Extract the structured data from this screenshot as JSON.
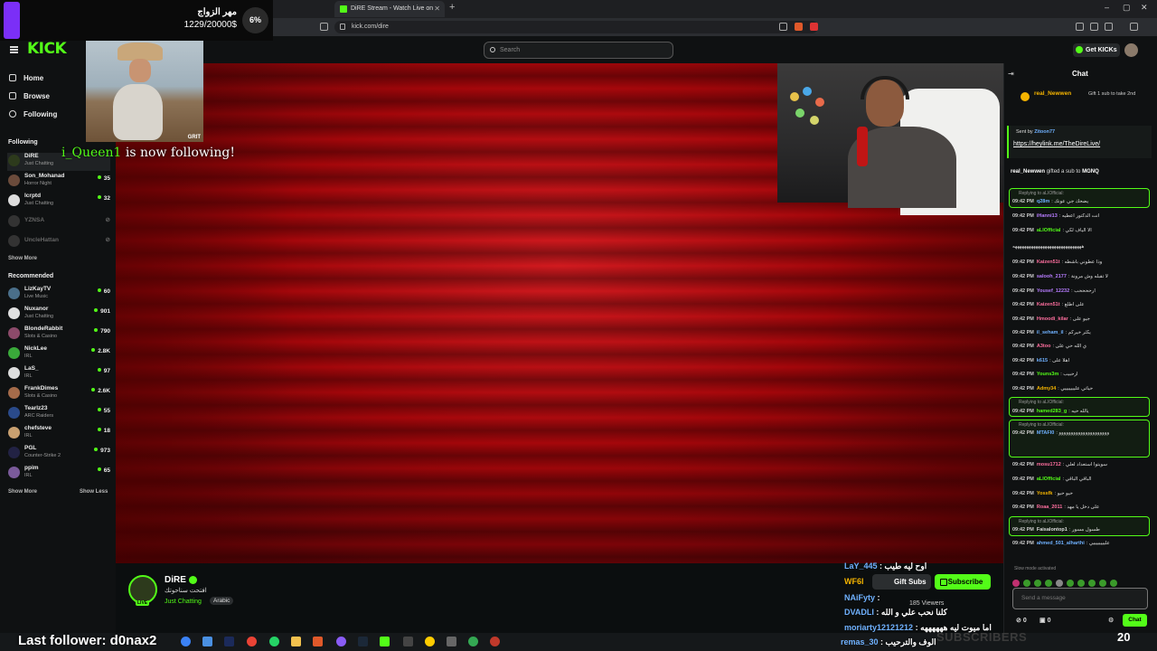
{
  "browser": {
    "tab_title": "DiRE Stream - Watch Live on",
    "url": "kick.com/dire"
  },
  "topnav": {
    "logo": "KICK",
    "search_placeholder": "Search",
    "get_kicks": "Get KICKs"
  },
  "sidebar": {
    "nav": [
      {
        "label": "Home"
      },
      {
        "label": "Browse"
      },
      {
        "label": "Following"
      }
    ],
    "following_title": "Following",
    "following": [
      {
        "name": "DiRE",
        "category": "Just Chatting",
        "viewers": ""
      },
      {
        "name": "Son_Mohanad",
        "category": "Horror Night",
        "viewers": "35"
      },
      {
        "name": "lcrptd",
        "category": "Just Chatting",
        "viewers": "32"
      },
      {
        "name": "YZNSA",
        "category": "",
        "viewers": ""
      },
      {
        "name": "UncleHattan",
        "category": "",
        "viewers": ""
      }
    ],
    "show_more_1": "Show More",
    "recommended_title": "Recommended",
    "recommended": [
      {
        "name": "LizKayTV",
        "category": "Live Music",
        "viewers": "60"
      },
      {
        "name": "Nuxanor",
        "category": "Just Chatting",
        "viewers": "901"
      },
      {
        "name": "BlondeRabbit",
        "category": "Slots & Casino",
        "viewers": "790"
      },
      {
        "name": "NickLee",
        "category": "IRL",
        "viewers": "2.8K"
      },
      {
        "name": "LaS_",
        "category": "IRL",
        "viewers": "97"
      },
      {
        "name": "FrankDimes",
        "category": "Slots & Casino",
        "viewers": "2.6K"
      },
      {
        "name": "Tearlz23",
        "category": "ARC Raiders",
        "viewers": "55"
      },
      {
        "name": "chefsteve",
        "category": "IRL",
        "viewers": "18"
      },
      {
        "name": "PGL",
        "category": "Counter-Strike 2",
        "viewers": "973"
      },
      {
        "name": "ppim",
        "category": "IRL",
        "viewers": "65"
      }
    ],
    "show_more_2": "Show More",
    "show_less": "Show Less"
  },
  "overlay": {
    "goal_title": "مهر الزواج",
    "goal_amount": "1229/20000$",
    "goal_percent": "6%",
    "clip_label": "GRIT",
    "follow_user": "i_Queen1",
    "follow_text": "is now following!",
    "last_follower": "Last follower: d0nax2",
    "subscribers_label": "SUBSCRIBERS",
    "subscribers_count": "20",
    "chat": [
      {
        "user": "LaY_445",
        "msg": "اوح ليه طيب"
      },
      {
        "user": "WF6l",
        "msg": ""
      },
      {
        "user": "NAiFyty",
        "msg": ""
      },
      {
        "user": "DVADLI",
        "msg": "كلنا نحب علي و الله"
      },
      {
        "user": "moriarty12121212",
        "msg": "اما ميوت ليه ههههههه"
      },
      {
        "user": "remas_30",
        "msg": "الوف والترحيب"
      }
    ]
  },
  "channel": {
    "name": "DiRE",
    "title": "افتحت سناحوتك",
    "category": "Just Chatting",
    "tag": "Arabic",
    "gift_subs": "Gift Subs",
    "subscribe": "Subscribe",
    "viewers": "185 Viewers",
    "live": "LIVE"
  },
  "chat": {
    "title": "Chat",
    "pinned_user": "real_Newwen",
    "pinned_text": "Gift 1 sub to take 2nd",
    "sent_by_prefix": "Sent by",
    "sent_by_user": "Zitoon77",
    "sent_link": "https://heylink.me/TheDireLive/",
    "gift_user": "real_Newwen",
    "gift_text": "gifted a sub to",
    "gift_target": "MGNQ",
    "messages": [
      {
        "reply": "Replying to aLIOfficial:",
        "time": "09:42 PM",
        "user": "q28m",
        "color": "#6fb1ff",
        "text": "يضحك جي عونك"
      },
      {
        "reply": "",
        "time": "09:42 PM",
        "user": "iHanni13",
        "color": "#b77cff",
        "text": "انت الدكتور اعطيه"
      },
      {
        "reply": "",
        "time": "09:42 PM",
        "user": "aLIOfficial",
        "color": "#53fc18",
        "text": "الا الياف لكي"
      },
      {
        "reply": "",
        "time": "",
        "user": "",
        "color": "#ddd",
        "text": "ههههههههههههههههههههههههههههههه"
      },
      {
        "reply": "",
        "time": "09:42 PM",
        "user": "Kaizen51t",
        "color": "#ff6f9f",
        "text": "وذا عطوني باشطه"
      },
      {
        "reply": "",
        "time": "09:42 PM",
        "user": "salooh_2177",
        "color": "#b77cff",
        "text": "لا تقبله وش مرونة"
      },
      {
        "reply": "",
        "time": "09:42 PM",
        "user": "Yousef_12232",
        "color": "#b77cff",
        "text": "ارححححب"
      },
      {
        "reply": "",
        "time": "09:42 PM",
        "user": "Kaizen51t",
        "color": "#ff6f9f",
        "text": "على اطلع"
      },
      {
        "reply": "",
        "time": "09:42 PM",
        "user": "Hmoodi_kilar",
        "color": "#ff6f9f",
        "text": "جيو على"
      },
      {
        "reply": "",
        "time": "09:42 PM",
        "user": "il_seham_il",
        "color": "#6fb1ff",
        "text": "يكثر خيركم"
      },
      {
        "reply": "",
        "time": "09:42 PM",
        "user": "A3too",
        "color": "#ff6f9f",
        "text": "ي الله حي على"
      },
      {
        "reply": "",
        "time": "09:42 PM",
        "user": "k615",
        "color": "#6fb1ff",
        "text": "اهلا على"
      },
      {
        "reply": "",
        "time": "09:42 PM",
        "user": "Youns3m",
        "color": "#53fc18",
        "text": "ارحبيب"
      },
      {
        "reply": "",
        "time": "09:42 PM",
        "user": "Admy34",
        "color": "#f5b400",
        "text": "حياتي عليييييييي"
      },
      {
        "reply": "Replying to aLIOfficial:",
        "time": "09:42 PM",
        "user": "hamed283_g",
        "color": "#53fc18",
        "text": "يالله حيه"
      },
      {
        "reply": "Replying to aLIOfficial:",
        "time": "09:42 PM",
        "user": "MTAFI0",
        "color": "#6fb1ff",
        "text": "ووووووووووووووووووووو"
      },
      {
        "reply": "",
        "time": "09:42 PM",
        "user": "mosu1712",
        "color": "#ff6f9f",
        "text": "سويتوا استعداد لعلي"
      },
      {
        "reply": "",
        "time": "09:42 PM",
        "user": "aLIOfficial",
        "color": "#53fc18",
        "text": "الباقي الباقي"
      },
      {
        "reply": "",
        "time": "09:42 PM",
        "user": "Yossfk",
        "color": "#f5b400",
        "text": "حيو حيو"
      },
      {
        "reply": "",
        "time": "09:42 PM",
        "user": "Roaa_2011",
        "color": "#ff6f9f",
        "text": "على دخل يا مهد"
      },
      {
        "reply": "Replying to aLIOfficial:",
        "time": "09:42 PM",
        "user": "Faisalontop1",
        "color": "#ddd",
        "text": "طسول مسور"
      },
      {
        "reply": "",
        "time": "09:42 PM",
        "user": "ahmed_501_alharthi",
        "color": "#6fb1ff",
        "text": "علييييييييي"
      }
    ],
    "slow_mode": "Slow mode activated",
    "placeholder": "Send a message",
    "points_1": "0",
    "points_2": "0",
    "send_label": "Chat"
  },
  "colors": {
    "kick_green": "#53fc18",
    "goal_purple": "#7b2ff7"
  }
}
